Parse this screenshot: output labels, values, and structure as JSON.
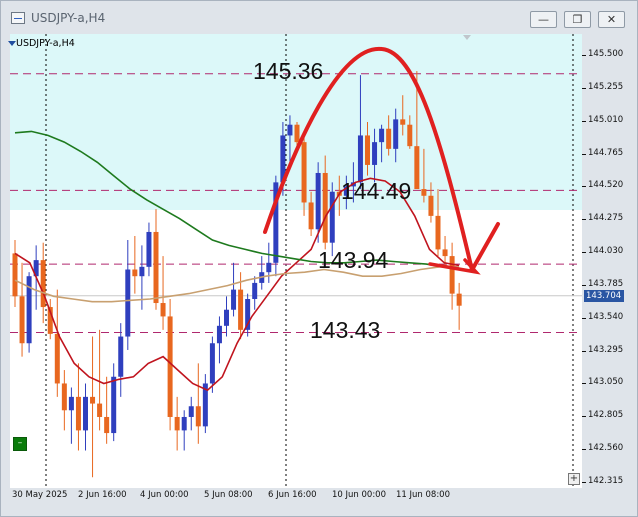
{
  "window": {
    "title": "USDJPY-a,H4",
    "minimize_glyph": "—",
    "restore_glyph": "❐",
    "close_glyph": "✕",
    "icon": "chart-window-icon"
  },
  "chart": {
    "symbol_label": "USDJPY-a,H4",
    "current_price": "143.704",
    "y_ticks": [
      "145.500",
      "145.255",
      "145.010",
      "144.765",
      "144.520",
      "144.275",
      "144.030",
      "143.785",
      "143.540",
      "143.295",
      "143.050",
      "142.805",
      "142.560",
      "142.315"
    ],
    "x_ticks": [
      "30 May 2025",
      "2 Jun 16:00",
      "4 Jun 00:00",
      "5 Jun 08:00",
      "6 Jun 16:00",
      "10 Jun 00:00",
      "11 Jun 08:00"
    ],
    "annotations": [
      "145.36",
      "144.49",
      "143.94",
      "143.43"
    ],
    "colors": {
      "bull": "#2f3fbe",
      "bear": "#e8671f",
      "level_line": "#b0286e",
      "ma_fast": "#c0141e",
      "ma_slow": "#1e7a1e",
      "ma_mid": "#c8a070",
      "arrow": "#e02020",
      "band": "#dcf8f9"
    }
  },
  "chart_data": {
    "type": "candlestick",
    "symbol": "USDJPY-a",
    "timeframe": "H4",
    "ylim": [
      142.315,
      145.6
    ],
    "x": [
      "30 May 2025",
      "2 Jun 16:00",
      "4 Jun 00:00",
      "5 Jun 08:00",
      "6 Jun 16:00",
      "10 Jun 00:00",
      "11 Jun 08:00"
    ],
    "levels": [
      145.36,
      144.49,
      143.94,
      143.43
    ],
    "last_price": 143.704,
    "candles": [
      [
        144.02,
        144.12,
        143.62,
        143.7
      ],
      [
        143.7,
        143.95,
        143.25,
        143.35
      ],
      [
        143.35,
        143.88,
        143.28,
        143.85
      ],
      [
        143.85,
        144.08,
        143.6,
        143.97
      ],
      [
        143.97,
        144.1,
        143.5,
        143.62
      ],
      [
        143.62,
        143.68,
        143.38,
        143.42
      ],
      [
        143.42,
        143.75,
        142.95,
        143.05
      ],
      [
        143.05,
        143.15,
        142.7,
        142.85
      ],
      [
        142.85,
        143.02,
        142.6,
        142.95
      ],
      [
        142.95,
        143.2,
        142.55,
        142.7
      ],
      [
        142.7,
        143.05,
        142.55,
        142.95
      ],
      [
        142.95,
        143.4,
        142.35,
        142.9
      ],
      [
        142.9,
        143.45,
        142.7,
        142.8
      ],
      [
        142.8,
        143.1,
        142.6,
        142.68
      ],
      [
        142.68,
        143.2,
        142.62,
        143.1
      ],
      [
        143.1,
        143.5,
        142.95,
        143.4
      ],
      [
        143.4,
        144.12,
        143.3,
        143.9
      ],
      [
        143.9,
        144.15,
        143.72,
        143.85
      ],
      [
        143.85,
        144.08,
        143.6,
        143.92
      ],
      [
        143.92,
        144.25,
        143.85,
        144.18
      ],
      [
        144.18,
        144.35,
        143.6,
        143.65
      ],
      [
        143.65,
        144.0,
        143.45,
        143.55
      ],
      [
        143.55,
        143.68,
        142.7,
        142.8
      ],
      [
        142.8,
        142.95,
        142.55,
        142.7
      ],
      [
        142.7,
        142.85,
        142.55,
        142.8
      ],
      [
        142.8,
        142.95,
        142.7,
        142.88
      ],
      [
        142.88,
        143.2,
        142.6,
        142.73
      ],
      [
        142.73,
        143.12,
        142.68,
        143.05
      ],
      [
        143.05,
        143.4,
        142.98,
        143.35
      ],
      [
        143.35,
        143.55,
        143.2,
        143.48
      ],
      [
        143.48,
        143.7,
        143.4,
        143.6
      ],
      [
        143.6,
        143.95,
        143.55,
        143.75
      ],
      [
        143.75,
        143.88,
        143.38,
        143.45
      ],
      [
        143.45,
        143.72,
        143.4,
        143.68
      ],
      [
        143.68,
        143.85,
        143.6,
        143.8
      ],
      [
        143.8,
        144.0,
        143.75,
        143.88
      ],
      [
        143.88,
        144.1,
        143.8,
        143.95
      ],
      [
        143.95,
        144.6,
        143.85,
        144.55
      ],
      [
        144.55,
        145.0,
        144.45,
        144.9
      ],
      [
        144.9,
        145.05,
        144.7,
        144.98
      ],
      [
        144.98,
        145.0,
        144.78,
        144.85
      ],
      [
        144.85,
        144.92,
        144.3,
        144.4
      ],
      [
        144.4,
        144.48,
        144.15,
        144.2
      ],
      [
        144.2,
        144.7,
        144.1,
        144.62
      ],
      [
        144.62,
        144.75,
        144.05,
        144.1
      ],
      [
        144.1,
        144.55,
        144.0,
        144.48
      ],
      [
        144.48,
        144.6,
        144.3,
        144.45
      ],
      [
        144.45,
        144.6,
        144.35,
        144.52
      ],
      [
        144.52,
        144.7,
        144.4,
        144.55
      ],
      [
        144.55,
        145.35,
        144.5,
        144.9
      ],
      [
        144.9,
        145.0,
        144.6,
        144.68
      ],
      [
        144.68,
        144.95,
        144.55,
        144.85
      ],
      [
        144.85,
        144.98,
        144.7,
        144.95
      ],
      [
        144.95,
        145.05,
        144.75,
        144.8
      ],
      [
        144.8,
        145.1,
        144.7,
        145.02
      ],
      [
        145.02,
        145.2,
        144.9,
        144.98
      ],
      [
        144.98,
        145.05,
        144.8,
        144.82
      ],
      [
        144.82,
        145.38,
        144.7,
        144.5
      ],
      [
        144.5,
        144.8,
        144.4,
        144.45
      ],
      [
        144.45,
        144.55,
        144.25,
        144.3
      ],
      [
        144.3,
        144.5,
        144.0,
        144.05
      ],
      [
        144.05,
        144.15,
        143.92,
        144.0
      ],
      [
        144.0,
        144.1,
        143.6,
        143.72
      ],
      [
        143.72,
        143.8,
        143.45,
        143.63
      ]
    ],
    "series": [
      {
        "values": [
          144.02,
          143.95,
          143.7,
          143.4,
          143.2,
          143.1,
          143.05,
          143.08,
          143.1,
          143.2,
          143.25,
          143.15,
          143.05,
          143.0,
          143.1,
          143.35,
          143.55,
          143.7,
          143.85,
          143.95,
          144.05,
          144.3,
          144.48,
          144.55,
          144.58,
          144.56,
          144.48,
          144.3,
          144.05,
          143.95,
          143.93
        ]
      },
      {
        "values": [
          144.92,
          144.93,
          144.9,
          144.85,
          144.78,
          144.7,
          144.6,
          144.5,
          144.42,
          144.35,
          144.28,
          144.2,
          144.12,
          144.08,
          144.05,
          144.02,
          144.0,
          143.98,
          143.96,
          143.95,
          143.95,
          143.96,
          143.97,
          143.96,
          143.95,
          143.94,
          143.92,
          143.9
        ]
      },
      {
        "values": [
          143.82,
          143.75,
          143.7,
          143.68,
          143.66,
          143.66,
          143.67,
          143.68,
          143.7,
          143.72,
          143.75,
          143.78,
          143.82,
          143.85,
          143.87,
          143.88,
          143.9,
          143.88,
          143.85,
          143.85,
          143.87,
          143.9,
          143.92,
          143.92
        ]
      }
    ]
  }
}
